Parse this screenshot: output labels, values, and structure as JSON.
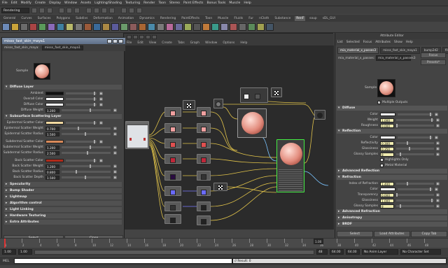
{
  "menubar": [
    "File",
    "Edit",
    "Modify",
    "Create",
    "Display",
    "Window",
    "Assets",
    "Lighting/Shading",
    "Texturing",
    "Render",
    "Toon",
    "Stereo",
    "Paint Effects",
    "Bonus Tools",
    "Muscle",
    "Help"
  ],
  "status_line": {
    "mode": "Rendering"
  },
  "shelf_tabs": [
    "General",
    "Curves",
    "Surfaces",
    "Polygons",
    "Subdivs",
    "Deformation",
    "Animation",
    "Dynamics",
    "Rendering",
    "PaintEffects",
    "Toon",
    "Muscle",
    "Fluids",
    "Fur",
    "nCloth",
    "Substance",
    "RenF",
    "soup",
    "sDL_GUI"
  ],
  "shelf_active": "RenF",
  "material_editor": {
    "title": "misss_fast_skin_maya1",
    "tab_label": "misss_fast_skin_maya:",
    "tab_value": "misss_fast_skin_maya1",
    "sample_label": "Sample",
    "sections": {
      "diffuse_layer": "Diffuse Layer",
      "sss_layer": "Subsurface Scattering Layer",
      "specularity": "Specularity",
      "bump_shader": "Bump Shader",
      "lightmap": "Lightmap",
      "algorithm_control": "Algorithm control",
      "light_linking": "Light Linking",
      "hardware_texturing": "Hardware Texturing",
      "extra_attributes": "Extra Attributes"
    },
    "diffuse": [
      {
        "label": "Ambient",
        "color": "#111111"
      },
      {
        "label": "Overall Color",
        "color": "#ffffff"
      },
      {
        "label": "Diffuse Color",
        "color": "#ffffff"
      },
      {
        "label": "Diffuse Weight",
        "value": "1.200",
        "pos": 0.6
      }
    ],
    "sss": [
      {
        "label": "Epidermal Scatter Color",
        "color": "#f2d9a0"
      },
      {
        "label": "Epidermal Scatter Weight",
        "value": "0.700",
        "pos": 0.35
      },
      {
        "label": "Epidermal Scatter Radius",
        "value": "1.500",
        "pos": 0.5
      },
      {
        "label": "Subdermal Scatter Color",
        "color": "#d98a5a"
      },
      {
        "label": "Subdermal Scatter Weight",
        "value": "1.200",
        "pos": 0.6
      },
      {
        "label": "Subdermal Scatter Radius",
        "value": "2.500",
        "pos": 0.55
      },
      {
        "label": "Back Scatter Color",
        "color": "#b02a1a"
      },
      {
        "label": "Back Scatter Weight",
        "value": "1.200",
        "pos": 0.6
      },
      {
        "label": "Back Scatter Radius",
        "value": "0.800",
        "pos": 0.3
      },
      {
        "label": "Back Scatter Depth",
        "value": "1.500",
        "pos": 0.5
      }
    ],
    "buttons": {
      "select": "Select",
      "close": "Close"
    }
  },
  "hypershade": {
    "menus": [
      "File",
      "Edit",
      "View",
      "Create",
      "Tabs",
      "Graph",
      "Window",
      "Options",
      "Help"
    ]
  },
  "attribute_editor": {
    "title": "Attribute Editor",
    "menus": [
      "List",
      "Selected",
      "Focus",
      "Attributes",
      "Show",
      "Help"
    ],
    "tabs": [
      "mia_material_x_passes3",
      "misss_fast_skin_maya1",
      "bump2d2",
      "file"
    ],
    "node_label": "mia_material_x_passes:",
    "node_value": "mia_material_x_passes3",
    "focus_btn": "Focus",
    "presets_btn": "Presets*",
    "sample_label": "Sample",
    "multiple_outputs": "Multiple Outputs",
    "diffuse_section": "Diffuse",
    "diffuse": [
      {
        "label": "Color",
        "color": "#ffffff"
      },
      {
        "label": "Weight",
        "value": "1.000",
        "pos": 1.0
      },
      {
        "label": "Roughness",
        "value": "0.000",
        "pos": 0.0
      }
    ],
    "reflection_section": "Reflection",
    "reflection": [
      {
        "label": "Color",
        "color": "#ffffff"
      },
      {
        "label": "Reflectivity",
        "value": "0.300",
        "pos": 0.3
      },
      {
        "label": "Glossiness",
        "value": "0.350",
        "pos": 0.35
      },
      {
        "label": "Glossy Samples",
        "value": "8",
        "pos": 0.1
      }
    ],
    "highlights_only": "Highlights Only",
    "metal_material": "Metal Material",
    "adv_reflection": "Advanced Reflection",
    "refraction_section": "Refraction",
    "refraction": [
      {
        "label": "Index of Refraction",
        "value": "1.400",
        "pos": 0.3
      },
      {
        "label": "Color",
        "color": "#ffffff"
      },
      {
        "label": "Transparency",
        "value": "0.000",
        "pos": 0.0
      },
      {
        "label": "Glossiness",
        "value": "1.000",
        "pos": 1.0
      },
      {
        "label": "Glossy Samples",
        "value": "8",
        "pos": 0.1
      }
    ],
    "adv_refraction": "Advanced Refraction",
    "anisotropy": "Anisotropy",
    "bsdf": "BRDF",
    "buttons": {
      "select": "Select",
      "load": "Load Attributes",
      "copy": "Copy Tab"
    }
  },
  "timeline": {
    "ticks": [
      "1",
      "2",
      "4",
      "6",
      "8",
      "10",
      "12",
      "14",
      "16",
      "18",
      "20",
      "22",
      "24",
      "26",
      "28",
      "30",
      "32",
      "34",
      "36",
      "38",
      "40",
      "42",
      "44",
      "46",
      "48"
    ],
    "current_frame": "1.00"
  },
  "range": {
    "start": "1.00",
    "start2": "1.00",
    "end": "48",
    "end2": "64.00",
    "end3": "64.00",
    "anim_layer": "No Anim Layer",
    "char_set": "No Character Set"
  },
  "command": {
    "label": "MEL",
    "result": "// Result: 0"
  }
}
